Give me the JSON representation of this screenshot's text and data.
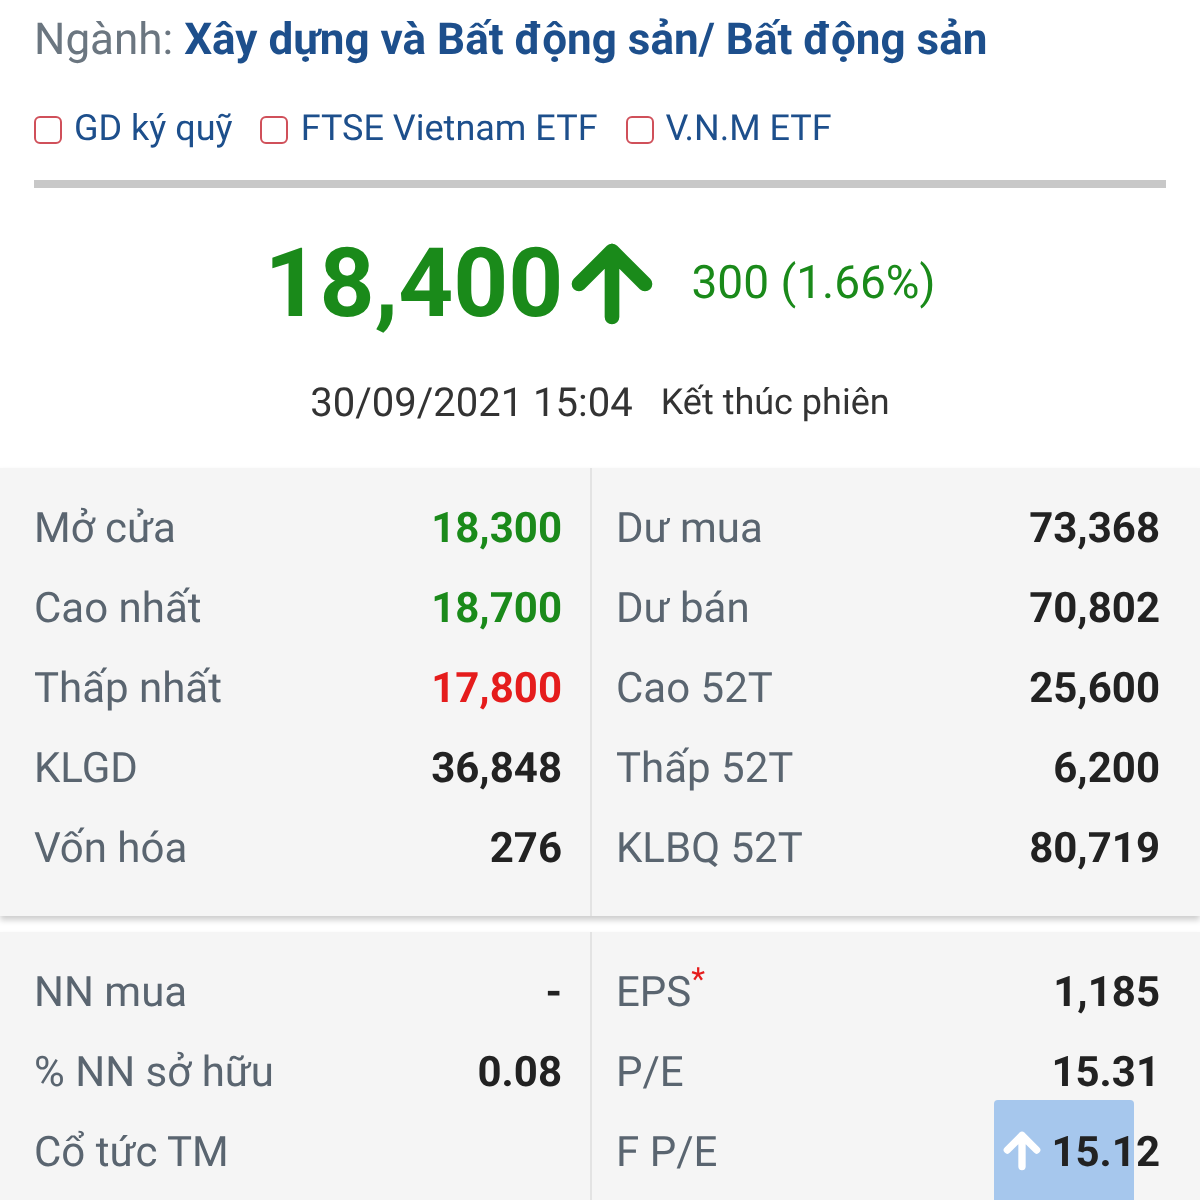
{
  "industry": {
    "label": "Ngành:",
    "value": "Xây dựng và Bất động sản/ Bất động sản"
  },
  "tags": [
    {
      "label": "GD ký quỹ",
      "checked": false
    },
    {
      "label": "FTSE Vietnam ETF",
      "checked": false
    },
    {
      "label": "V.N.M ETF",
      "checked": false
    }
  ],
  "price": {
    "value": "18,400",
    "rising": true,
    "change": "300 (1.66%)"
  },
  "session": {
    "time": "30/09/2021 15:04",
    "status": "Kết thúc phiên"
  },
  "panels": [
    {
      "left": [
        {
          "label": "Mở cửa",
          "value": "18,300",
          "kind": "rise"
        },
        {
          "label": "Cao nhất",
          "value": "18,700",
          "kind": "rise"
        },
        {
          "label": "Thấp nhất",
          "value": "17,800",
          "kind": "fall"
        },
        {
          "label": "KLGD",
          "value": "36,848",
          "kind": "flat"
        },
        {
          "label": "Vốn hóa",
          "value": "276",
          "kind": "flat"
        }
      ],
      "right": [
        {
          "label": "Dư mua",
          "value": "73,368",
          "kind": "flat"
        },
        {
          "label": "Dư bán",
          "value": "70,802",
          "kind": "flat"
        },
        {
          "label": "Cao 52T",
          "value": "25,600",
          "kind": "flat"
        },
        {
          "label": "Thấp 52T",
          "value": "6,200",
          "kind": "flat"
        },
        {
          "label": "KLBQ 52T",
          "value": "80,719",
          "kind": "flat"
        }
      ]
    },
    {
      "left": [
        {
          "label": "NN mua",
          "value": "-",
          "kind": "flat"
        },
        {
          "label": "% NN sở hữu",
          "value": "0.08",
          "kind": "flat"
        },
        {
          "label": "Cổ tức TM"
        }
      ],
      "right": [
        {
          "label": "EPS",
          "note": "*",
          "value": "1,185",
          "kind": "flat"
        },
        {
          "label": "P/E",
          "value": "15.31",
          "kind": "flat"
        },
        {
          "label": "F P/E",
          "value": "15.12",
          "kind": "flat"
        }
      ]
    }
  ]
}
